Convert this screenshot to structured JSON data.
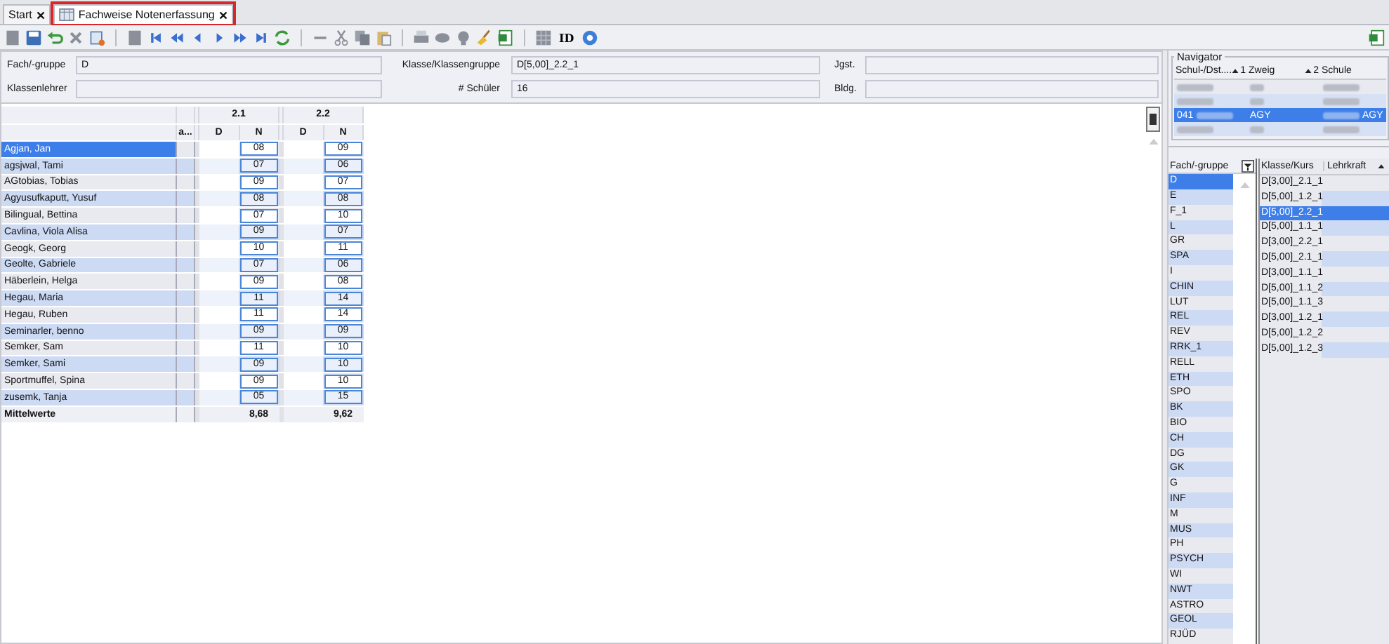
{
  "tabs": [
    {
      "label": "Start",
      "selected": false
    },
    {
      "label": "Fachweise Notenerfassung",
      "selected": true
    }
  ],
  "toolbar": {
    "id_label": "ID"
  },
  "form": [
    {
      "label": "Fach/-gruppe",
      "value": "D"
    },
    {
      "label": "Klasse/Klassengruppe",
      "value": "D[5,00]_2.2_1"
    },
    {
      "label": "Jgst."
    },
    {
      "label": "Klassenlehrer"
    },
    {
      "label": "# Schüler",
      "value": "16"
    },
    {
      "label": "Bldg."
    }
  ],
  "grade_table": {
    "extra_column": "a...",
    "groups": [
      {
        "title": "2.1",
        "subcolumns": [
          "D",
          "N"
        ]
      },
      {
        "title": "2.2",
        "subcolumns": [
          "D",
          "N"
        ]
      }
    ],
    "rows": [
      {
        "name": "Agjan, Jan",
        "selected": true,
        "grades": [
          "08",
          "09"
        ]
      },
      {
        "name": "agsjwal, Tami",
        "selected": false,
        "grades": [
          "07",
          "06"
        ]
      },
      {
        "name": "AGtobias, Tobias",
        "selected": false,
        "grades": [
          "09",
          "07"
        ]
      },
      {
        "name": "Agyusufkaputt, Yusuf",
        "selected": false,
        "grades": [
          "08",
          "08"
        ]
      },
      {
        "name": "Bilingual, Bettina",
        "selected": false,
        "grades": [
          "07",
          "10"
        ]
      },
      {
        "name": "Cavlina, Viola Alisa",
        "selected": false,
        "grades": [
          "09",
          "07"
        ]
      },
      {
        "name": "Geogk, Georg",
        "selected": false,
        "grades": [
          "10",
          "11"
        ]
      },
      {
        "name": "Geolte, Gabriele",
        "selected": false,
        "grades": [
          "07",
          "06"
        ]
      },
      {
        "name": "Häberlein, Helga",
        "selected": false,
        "grades": [
          "09",
          "08"
        ]
      },
      {
        "name": "Hegau, Maria",
        "selected": false,
        "grades": [
          "11",
          "14"
        ]
      },
      {
        "name": "Hegau, Ruben",
        "selected": false,
        "grades": [
          "11",
          "14"
        ]
      },
      {
        "name": "Seminarler, benno",
        "selected": false,
        "grades": [
          "09",
          "09"
        ]
      },
      {
        "name": "Semker, Sam",
        "selected": false,
        "grades": [
          "11",
          "10"
        ]
      },
      {
        "name": "Semker, Sami",
        "selected": false,
        "grades": [
          "09",
          "10"
        ]
      },
      {
        "name": "Sportmuffel, Spina",
        "selected": false,
        "grades": [
          "09",
          "10"
        ]
      },
      {
        "name": "zusemk, Tanja",
        "selected": false,
        "grades": [
          "05",
          "15"
        ]
      }
    ],
    "footer": {
      "label": "Mittelwerte",
      "averages": [
        "8,68",
        "9,62"
      ]
    }
  },
  "navigator": {
    "title": "Navigator",
    "columns": [
      {
        "label": "Schul-/Dst....",
        "sort_rank": "1"
      },
      {
        "label": "Zweig",
        "sort_rank": "2"
      },
      {
        "label": "Schule"
      }
    ],
    "rows": [
      {
        "selected": false
      },
      {
        "selected": false
      },
      {
        "selected": true,
        "cells": [
          "041",
          "AGY",
          "AGY"
        ]
      },
      {
        "selected": false
      }
    ]
  },
  "subjects": {
    "header": "Fach/-gruppe",
    "items": [
      {
        "label": "D",
        "selected": true
      },
      {
        "label": "E",
        "selected": false
      },
      {
        "label": "F_1",
        "selected": false
      },
      {
        "label": "L",
        "selected": false
      },
      {
        "label": "GR",
        "selected": false
      },
      {
        "label": "SPA",
        "selected": false
      },
      {
        "label": "I",
        "selected": false
      },
      {
        "label": "CHIN",
        "selected": false
      },
      {
        "label": "LUT",
        "selected": false
      },
      {
        "label": "REL",
        "selected": false
      },
      {
        "label": "REV",
        "selected": false
      },
      {
        "label": "RRK_1",
        "selected": false
      },
      {
        "label": "RELL",
        "selected": false
      },
      {
        "label": "ETH",
        "selected": false
      },
      {
        "label": "SPO",
        "selected": false
      },
      {
        "label": "BK",
        "selected": false
      },
      {
        "label": "BIO",
        "selected": false
      },
      {
        "label": "CH",
        "selected": false
      },
      {
        "label": "DG",
        "selected": false
      },
      {
        "label": "GK",
        "selected": false
      },
      {
        "label": "G",
        "selected": false
      },
      {
        "label": "INF",
        "selected": false
      },
      {
        "label": "M",
        "selected": false
      },
      {
        "label": "MUS",
        "selected": false
      },
      {
        "label": "PH",
        "selected": false
      },
      {
        "label": "PSYCH",
        "selected": false
      },
      {
        "label": "WI",
        "selected": false
      },
      {
        "label": "NWT",
        "selected": false
      },
      {
        "label": "ASTRO",
        "selected": false
      },
      {
        "label": "GEOL",
        "selected": false
      },
      {
        "label": "RJÜD",
        "selected": false
      }
    ]
  },
  "courses": {
    "columns": [
      "Klasse/Kurs",
      "Lehrkraft"
    ],
    "items": [
      {
        "label": "D[3,00]_2.1_1",
        "selected": false
      },
      {
        "label": "D[5,00]_1.2_1",
        "selected": false
      },
      {
        "label": "D[5,00]_2.2_1",
        "selected": true
      },
      {
        "label": "D[5,00]_1.1_1",
        "selected": false
      },
      {
        "label": "D[3,00]_2.2_1",
        "selected": false
      },
      {
        "label": "D[5,00]_2.1_1",
        "selected": false
      },
      {
        "label": "D[3,00]_1.1_1",
        "selected": false
      },
      {
        "label": "D[5,00]_1.1_2",
        "selected": false
      },
      {
        "label": "D[5,00]_1.1_3",
        "selected": false
      },
      {
        "label": "D[3,00]_1.2_1",
        "selected": false
      },
      {
        "label": "D[5,00]_1.2_2",
        "selected": false
      },
      {
        "label": "D[5,00]_1.2_3",
        "selected": false
      }
    ]
  }
}
